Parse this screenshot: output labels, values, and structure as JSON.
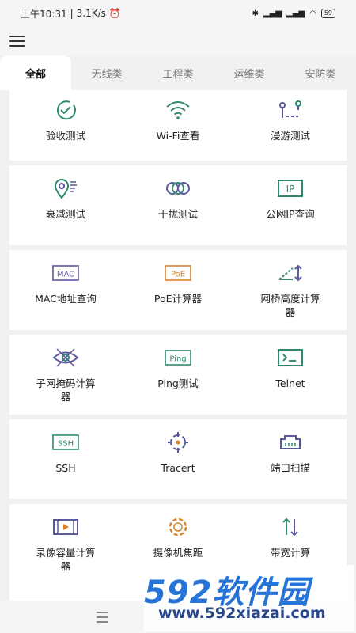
{
  "status": {
    "time": "上午10:31",
    "speed": "3.1K/s",
    "battery": "59"
  },
  "tabs": [
    {
      "label": "全部",
      "active": true
    },
    {
      "label": "无线类",
      "active": false
    },
    {
      "label": "工程类",
      "active": false
    },
    {
      "label": "运维类",
      "active": false
    },
    {
      "label": "安防类",
      "active": false
    }
  ],
  "tools": [
    {
      "label": "验收测试",
      "icon": "check-circle-icon"
    },
    {
      "label": "Wi-Fi查看",
      "icon": "wifi-icon"
    },
    {
      "label": "漫游测试",
      "icon": "roaming-icon"
    },
    {
      "label": "衰减测试",
      "icon": "location-signal-icon"
    },
    {
      "label": "干扰测试",
      "icon": "rings-icon"
    },
    {
      "label": "公网IP查询",
      "icon": "ip-icon"
    },
    {
      "label": "MAC地址查询",
      "icon": "mac-icon"
    },
    {
      "label": "PoE计算器",
      "icon": "poe-icon"
    },
    {
      "label": "网桥高度计算器",
      "icon": "bridge-height-icon"
    },
    {
      "label": "子网掩码计算器",
      "icon": "subnet-eye-icon"
    },
    {
      "label": "Ping测试",
      "icon": "ping-icon"
    },
    {
      "label": "Telnet",
      "icon": "terminal-icon"
    },
    {
      "label": "SSH",
      "icon": "ssh-icon"
    },
    {
      "label": "Tracert",
      "icon": "crosshair-icon"
    },
    {
      "label": "端口扫描",
      "icon": "port-icon"
    },
    {
      "label": "录像容量计算器",
      "icon": "video-icon"
    },
    {
      "label": "摄像机焦距",
      "icon": "focus-icon"
    },
    {
      "label": "带宽计算",
      "icon": "updown-arrows-icon"
    }
  ],
  "watermark": {
    "logo": "592软件园",
    "url": "www.592xiazai.com"
  },
  "colors": {
    "icon_green": "#2e8b6e",
    "icon_orange": "#d9822b",
    "icon_purple": "#5a5a9e",
    "watermark_blue": "#1e6fd8"
  }
}
